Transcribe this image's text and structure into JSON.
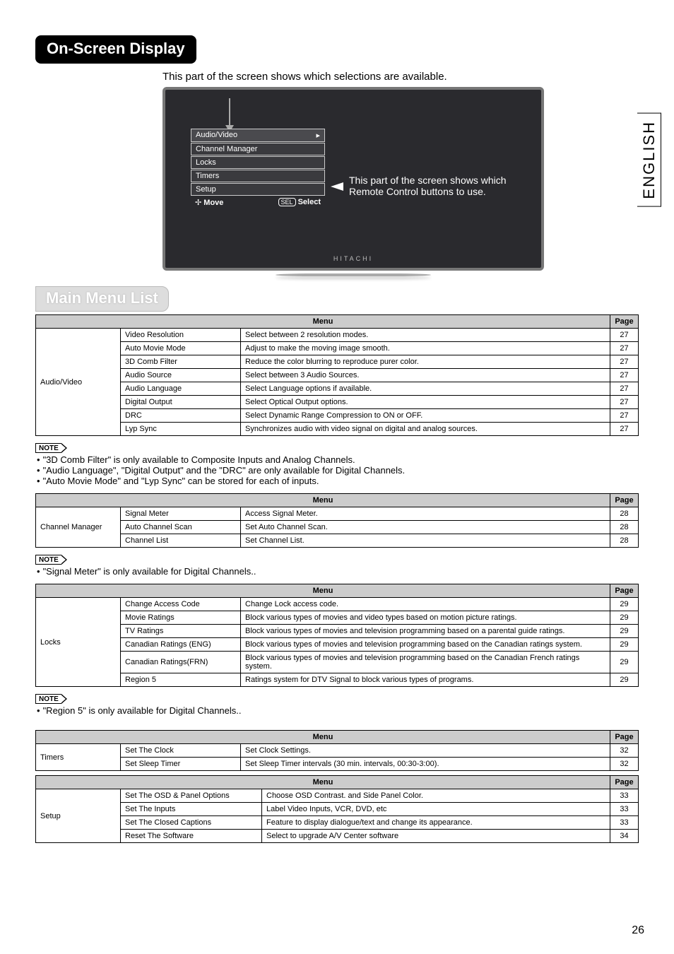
{
  "page": {
    "sidebar_lang": "ENGLISH",
    "number": "26",
    "header_title": "On-Screen Display",
    "intro_text": "This part of the screen shows which selections are available.",
    "section_title": "Main Menu List"
  },
  "tv": {
    "menu": [
      "Audio/Video",
      "Channel Manager",
      "Locks",
      "Timers",
      "Setup"
    ],
    "nav_move_glyph": "✢",
    "nav_move": "Move",
    "nav_sel_btn": "SEL",
    "nav_select": "Select",
    "arrow_right": "▸",
    "caption": "This part of the screen shows which Remote Control buttons to use.",
    "brand": "HITACHI"
  },
  "table_headers": {
    "menu": "Menu",
    "page": "Page"
  },
  "audio_video": {
    "section": "Audio/Video",
    "rows": [
      {
        "opt": "Video Resolution",
        "desc": "Select between 2 resolution modes.",
        "pg": "27"
      },
      {
        "opt": "Auto Movie Mode",
        "desc": "Adjust to make the moving image smooth.",
        "pg": "27"
      },
      {
        "opt": "3D Comb Filter",
        "desc": "Reduce the color blurring to reproduce purer color.",
        "pg": "27"
      },
      {
        "opt": "Audio Source",
        "desc": "Select between 3 Audio Sources.",
        "pg": "27"
      },
      {
        "opt": "Audio Language",
        "desc": "Select Language options if available.",
        "pg": "27"
      },
      {
        "opt": "Digital Output",
        "desc": "Select Optical Output options.",
        "pg": "27"
      },
      {
        "opt": "DRC",
        "desc": "Select Dynamic Range Compression to ON or OFF.",
        "pg": "27"
      },
      {
        "opt": "Lyp Sync",
        "desc": "Synchronizes audio with video signal on digital and analog sources.",
        "pg": "27"
      }
    ]
  },
  "notes": {
    "label": "NOTE",
    "av": [
      "\"3D Comb Filter\" is only available to Composite Inputs and Analog Channels.",
      "\"Audio Language\", \"Digital Output\" and the \"DRC\" are only available for Digital Channels.",
      "\"Auto Movie Mode\" and \"Lyp Sync\" can be stored for each of inputs."
    ],
    "cm": [
      "\"Signal Meter\" is only available for Digital Channels.."
    ],
    "locks": [
      "\"Region 5\" is only available for Digital Channels.."
    ]
  },
  "channel_manager": {
    "section": "Channel Manager",
    "rows": [
      {
        "opt": "Signal Meter",
        "desc": "Access Signal Meter.",
        "pg": "28"
      },
      {
        "opt": "Auto Channel Scan",
        "desc": "Set Auto Channel Scan.",
        "pg": "28"
      },
      {
        "opt": "Channel List",
        "desc": "Set Channel List.",
        "pg": "28"
      }
    ]
  },
  "locks": {
    "section": "Locks",
    "rows": [
      {
        "opt": "Change Access Code",
        "desc": "Change Lock access code.",
        "pg": "29"
      },
      {
        "opt": "Movie Ratings",
        "desc": "Block various types of movies and video types based on motion picture ratings.",
        "pg": "29"
      },
      {
        "opt": "TV Ratings",
        "desc": "Block various types of movies and television programming based on a parental guide ratings.",
        "pg": "29"
      },
      {
        "opt": "Canadian Ratings (ENG)",
        "desc": "Block various types of movies and television programming based on the Canadian ratings system.",
        "pg": "29"
      },
      {
        "opt": "Canadian Ratings(FRN)",
        "desc": "Block various types of movies and television programming based on the Canadian French ratings system.",
        "pg": "29"
      },
      {
        "opt": "Region 5",
        "desc": "Ratings system for DTV Signal to block various types of programs.",
        "pg": "29"
      }
    ]
  },
  "timers": {
    "section": "Timers",
    "rows": [
      {
        "opt": "Set The Clock",
        "desc": "Set Clock Settings.",
        "pg": "32"
      },
      {
        "opt": "Set Sleep Timer",
        "desc": "Set Sleep Timer intervals (30 min. intervals, 00:30-3:00).",
        "pg": "32"
      }
    ]
  },
  "setup": {
    "section": "Setup",
    "rows": [
      {
        "opt": "Set The OSD & Panel Options",
        "desc": "Choose OSD Contrast. and Side Panel Color.",
        "pg": "33"
      },
      {
        "opt": "Set The Inputs",
        "desc": "Label Video Inputs, VCR, DVD, etc",
        "pg": "33"
      },
      {
        "opt": "Set The Closed Captions",
        "desc": "Feature to display dialogue/text and change its appearance.",
        "pg": "33"
      },
      {
        "opt": "Reset The Software",
        "desc": "Select to upgrade A/V Center software",
        "pg": "34"
      }
    ]
  }
}
